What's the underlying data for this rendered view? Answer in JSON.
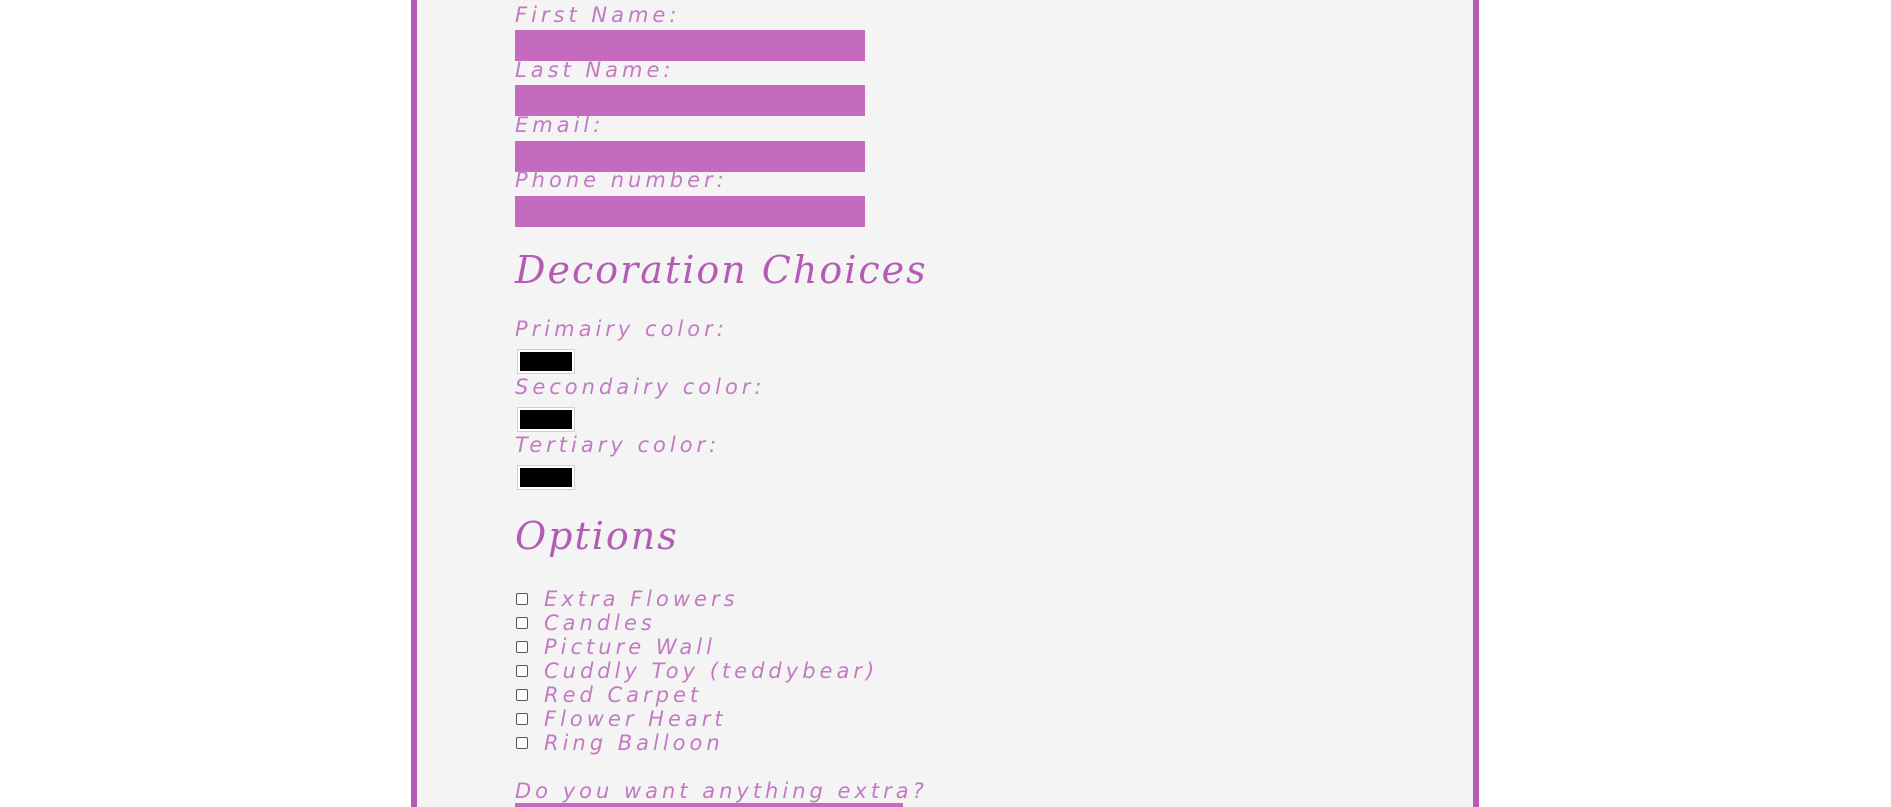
{
  "contact": {
    "first_name_label": "First Name:",
    "last_name_label": "Last Name:",
    "email_label": "Email:",
    "phone_label": "Phone number:",
    "first_name_value": "",
    "last_name_value": "",
    "email_value": "",
    "phone_value": ""
  },
  "decoration": {
    "heading": "Decoration Choices",
    "primary_label": "Primairy color:",
    "secondary_label": "Secondairy color:",
    "tertiary_label": "Tertiary color:",
    "primary_value": "#000000",
    "secondary_value": "#000000",
    "tertiary_value": "#000000"
  },
  "options": {
    "heading": "Options",
    "items": [
      {
        "label": "Extra Flowers",
        "checked": false
      },
      {
        "label": "Candles",
        "checked": false
      },
      {
        "label": "Picture Wall",
        "checked": false
      },
      {
        "label": "Cuddly Toy (teddybear)",
        "checked": false
      },
      {
        "label": "Red Carpet",
        "checked": false
      },
      {
        "label": "Flower Heart",
        "checked": false
      },
      {
        "label": "Ring Balloon",
        "checked": false
      }
    ]
  },
  "extra": {
    "label": "Do you want anything extra?"
  },
  "colors": {
    "accent": "#b35bb5",
    "input_fill": "#c46bbf",
    "label_text": "#c479c3",
    "panel_bg": "#f4f4f4"
  }
}
